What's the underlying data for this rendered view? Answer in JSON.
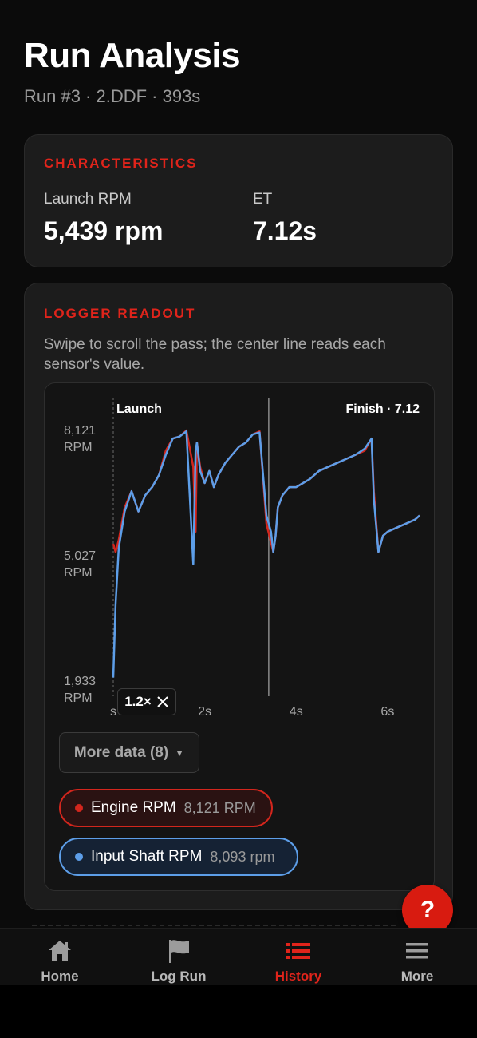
{
  "header": {
    "title": "Run Analysis",
    "subtitle": "Run #3  ·  2.DDF · 393s"
  },
  "characteristics": {
    "section_title": "CHARACTERISTICS",
    "launch_rpm_label": "Launch RPM",
    "launch_rpm_value": "5,439 rpm",
    "et_label": "ET",
    "et_value": "7.12s"
  },
  "logger": {
    "section_title": "LOGGER READOUT",
    "description": "Swipe to scroll the pass; the center line reads each sensor's value.",
    "zoom_label": "1.2×",
    "more_data_label": "More data (8)",
    "chips": [
      {
        "label": "Engine RPM",
        "value": "8,121 RPM",
        "color": "#d3261d"
      },
      {
        "label": "Input Shaft RPM",
        "value": "8,093 rpm",
        "color": "#5d9ee8"
      }
    ]
  },
  "chart_data": {
    "type": "line",
    "title": "",
    "xlabel": "",
    "ylabel": "",
    "markers": {
      "launch": "Launch",
      "finish": "Finish · 7.12"
    },
    "y_ticks": [
      {
        "value": 8121,
        "label": "8,121",
        "unit": "RPM"
      },
      {
        "value": 5027,
        "label": "5,027",
        "unit": "RPM"
      },
      {
        "value": 1933,
        "label": "1,933",
        "unit": "RPM"
      }
    ],
    "x_ticks": [
      {
        "value": 0,
        "label": "s"
      },
      {
        "value": 2,
        "label": "2s"
      },
      {
        "value": 4,
        "label": "4s"
      },
      {
        "value": 6,
        "label": "6s"
      }
    ],
    "xlim": [
      0,
      6.7
    ],
    "ylim": [
      1933,
      8121
    ],
    "series": [
      {
        "name": "Engine RPM",
        "color": "#d3261d",
        "x": [
          0.0,
          0.05,
          0.12,
          0.25,
          0.4,
          0.55,
          0.7,
          0.85,
          1.0,
          1.15,
          1.3,
          1.45,
          1.6,
          1.75,
          1.8,
          1.83,
          1.9,
          2.0,
          2.1,
          2.2,
          2.3,
          2.45,
          2.6,
          2.75,
          2.9,
          3.05,
          3.2,
          3.35,
          3.5,
          3.55,
          3.6,
          3.7,
          3.85,
          4.0,
          4.15,
          4.3,
          4.5,
          4.7,
          4.9,
          5.1,
          5.3,
          5.5,
          5.65,
          5.7,
          5.8,
          5.9,
          6.0,
          6.2,
          6.4,
          6.6,
          6.7
        ],
        "y": [
          5300,
          5100,
          5400,
          6200,
          6600,
          6100,
          6500,
          6700,
          7000,
          7600,
          7900,
          7950,
          8100,
          7200,
          5600,
          7800,
          7200,
          6800,
          7100,
          6700,
          7000,
          7300,
          7500,
          7700,
          7800,
          8000,
          8080,
          5800,
          5100,
          5500,
          6200,
          6500,
          6700,
          6700,
          6800,
          6900,
          7100,
          7200,
          7300,
          7400,
          7500,
          7600,
          7900,
          6600,
          5100,
          5500,
          5600,
          5700,
          5800,
          5900,
          6000
        ]
      },
      {
        "name": "Input Shaft RPM",
        "color": "#5d9ee8",
        "x": [
          0.0,
          0.05,
          0.12,
          0.25,
          0.4,
          0.55,
          0.7,
          0.85,
          1.0,
          1.15,
          1.3,
          1.45,
          1.6,
          1.75,
          1.8,
          1.83,
          1.9,
          2.0,
          2.1,
          2.2,
          2.3,
          2.45,
          2.6,
          2.75,
          2.9,
          3.05,
          3.2,
          3.35,
          3.45,
          3.5,
          3.55,
          3.6,
          3.7,
          3.85,
          4.0,
          4.15,
          4.3,
          4.5,
          4.7,
          4.9,
          5.1,
          5.3,
          5.5,
          5.65,
          5.7,
          5.8,
          5.9,
          6.0,
          6.2,
          6.4,
          6.6,
          6.7
        ],
        "y": [
          2000,
          3800,
          5200,
          6100,
          6600,
          6100,
          6500,
          6700,
          7000,
          7500,
          7900,
          7950,
          8080,
          4800,
          7600,
          7800,
          7100,
          6800,
          7100,
          6700,
          7000,
          7300,
          7500,
          7700,
          7800,
          8000,
          8050,
          6000,
          5600,
          5100,
          5500,
          6200,
          6500,
          6700,
          6700,
          6800,
          6900,
          7100,
          7200,
          7300,
          7400,
          7500,
          7650,
          7900,
          6400,
          5100,
          5500,
          5600,
          5700,
          5800,
          5900,
          6000
        ]
      }
    ]
  },
  "nav": {
    "items": [
      {
        "label": "Home",
        "icon": "home-icon"
      },
      {
        "label": "Log Run",
        "icon": "flag-icon"
      },
      {
        "label": "History",
        "icon": "list-icon"
      },
      {
        "label": "More",
        "icon": "menu-icon"
      }
    ],
    "active_color": "#e0241b"
  },
  "help_label": "?"
}
